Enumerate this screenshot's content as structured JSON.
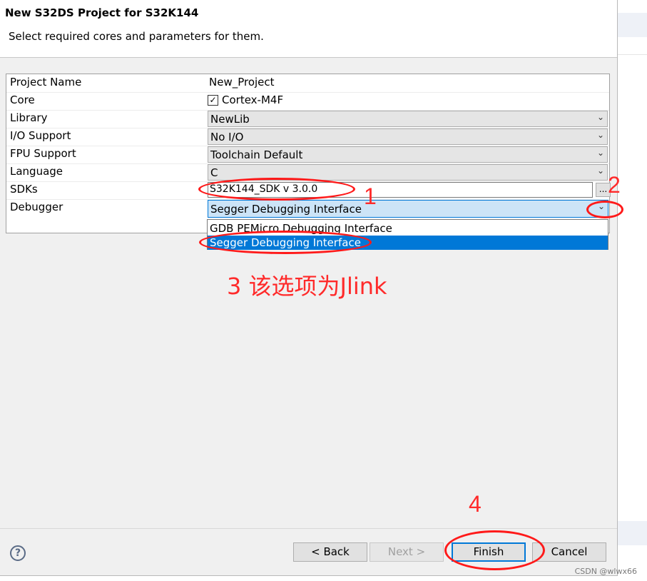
{
  "dialog": {
    "title": "New S32DS Project for S32K144",
    "subtitle": "Select required cores and parameters for them."
  },
  "fields": {
    "project_name": {
      "label": "Project Name",
      "value": "New_Project"
    },
    "core": {
      "label": "Core",
      "value": "Cortex-M4F",
      "checked": true
    },
    "library": {
      "label": "Library",
      "value": "NewLib"
    },
    "io_support": {
      "label": "I/O Support",
      "value": "No I/O"
    },
    "fpu_support": {
      "label": "FPU Support",
      "value": "Toolchain Default"
    },
    "language": {
      "label": "Language",
      "value": "C"
    },
    "sdks": {
      "label": "SDKs",
      "value": "S32K144_SDK v 3.0.0",
      "browse_label": "..."
    },
    "debugger": {
      "label": "Debugger",
      "value": "Segger Debugging Interface",
      "options": [
        "GDB PEMicro Debugging Interface",
        "Segger Debugging Interface"
      ]
    }
  },
  "annotations": {
    "n1": "1",
    "n2": "2",
    "n3": "3 该选项为Jlink",
    "n4": "4",
    "color": "#ff2a2a"
  },
  "buttons": {
    "help": "?",
    "back": "< Back",
    "next": "Next >",
    "finish": "Finish",
    "cancel": "Cancel"
  },
  "watermark": "CSDN @wlwx66",
  "icons": {
    "chevron": "chevron-down-icon",
    "help": "help-icon",
    "checkbox": "checkmark-icon"
  },
  "colors": {
    "selection": "#0078d7",
    "combo_focus": "#cce4f7"
  }
}
